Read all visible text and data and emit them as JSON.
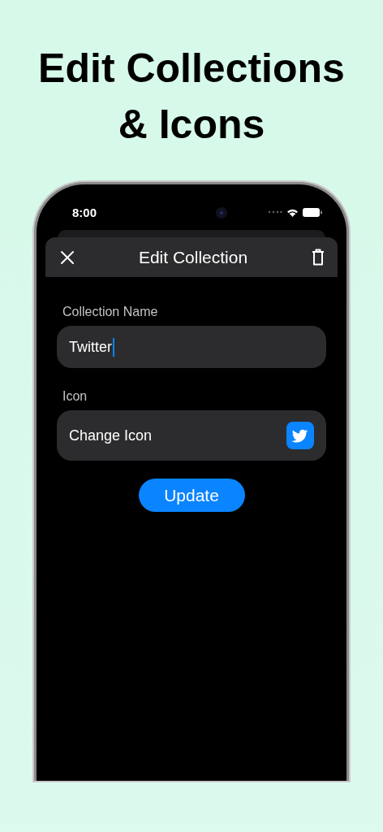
{
  "headline": "Edit Collections & Icons",
  "status_bar": {
    "time": "8:00"
  },
  "sheet": {
    "title": "Edit Collection"
  },
  "form": {
    "name_label": "Collection Name",
    "name_value": "Twitter",
    "icon_label": "Icon",
    "icon_row_label": "Change Icon"
  },
  "submit_button": "Update"
}
